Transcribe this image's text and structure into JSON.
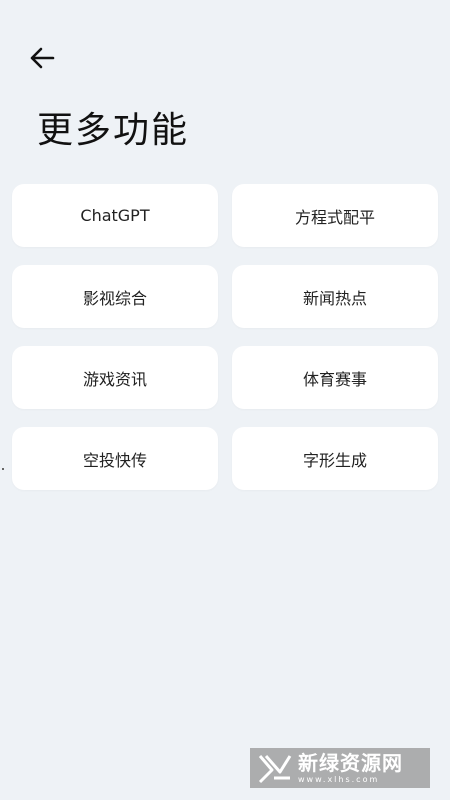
{
  "header": {
    "back_icon": "arrow-left-icon",
    "title": "更多功能"
  },
  "features": [
    {
      "label": "ChatGPT"
    },
    {
      "label": "方程式配平"
    },
    {
      "label": "影视综合"
    },
    {
      "label": "新闻热点"
    },
    {
      "label": "游戏资讯"
    },
    {
      "label": "体育赛事"
    },
    {
      "label": "空投快传"
    },
    {
      "label": "字形生成"
    }
  ],
  "watermark": {
    "title": "新绿资源网",
    "url": "www.xlhs.com"
  },
  "colors": {
    "background": "#eef2f6",
    "tile": "#ffffff",
    "text": "#222222"
  }
}
